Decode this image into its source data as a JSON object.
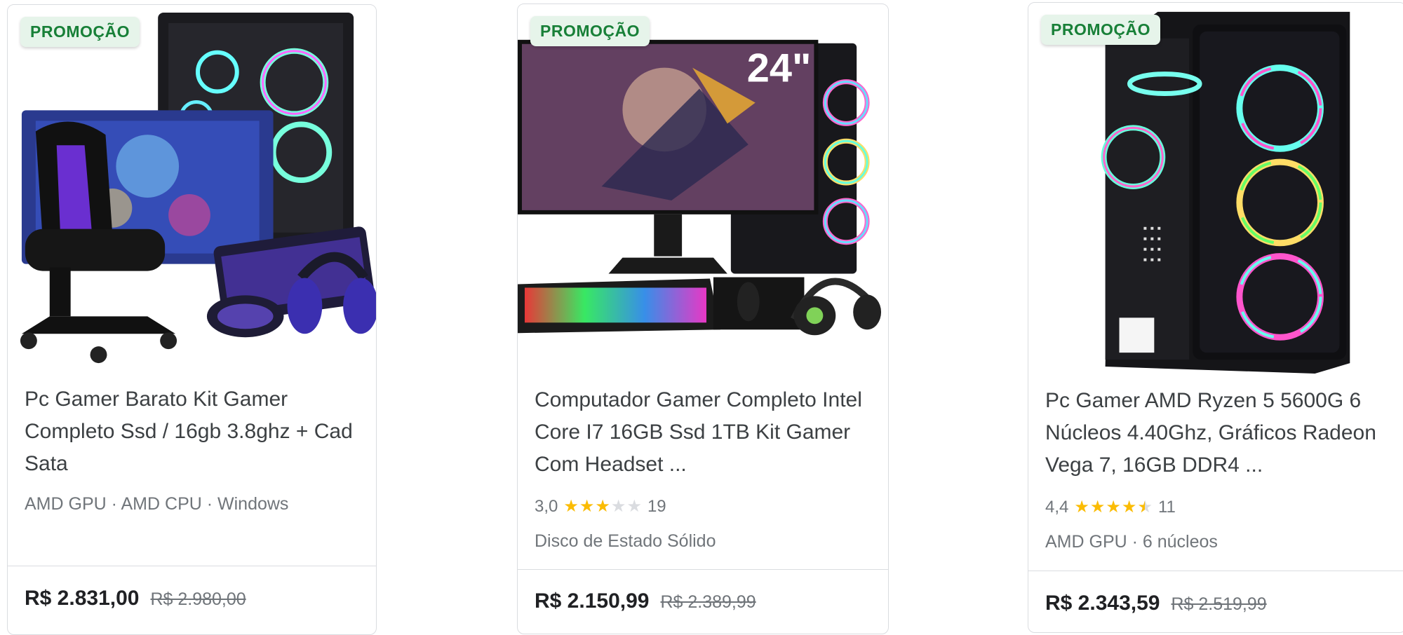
{
  "products": [
    {
      "badge": "PROMOÇÃO",
      "title": "Pc Gamer Barato Kit Gamer Completo Ssd / 16gb 3.8ghz + Cad Sata",
      "meta": "AMD GPU · AMD CPU · Windows",
      "price": "R$ 2.831,00",
      "old_price": "R$ 2.980,00",
      "image_icon": "gamer-kit-chair-image"
    },
    {
      "badge": "PROMOÇÃO",
      "title": "Computador Gamer Completo Intel Core I7 16GB Ssd 1TB Kit Gamer Com Headset ...",
      "rating_value": "3,0",
      "rating": 3.0,
      "review_count": "19",
      "meta": "Disco de Estado Sólido",
      "price": "R$ 2.150,99",
      "old_price": "R$ 2.389,99",
      "monitor_label": "24\"",
      "image_icon": "monitor-pc-kit-image"
    },
    {
      "badge": "PROMOÇÃO",
      "title": "Pc Gamer AMD Ryzen 5 5600G 6 Núcleos 4.40Ghz, Gráficos Radeon Vega 7, 16GB DDR4 ...",
      "rating_value": "4,4",
      "rating": 4.4,
      "review_count": "11",
      "meta": "AMD GPU · 6 núcleos",
      "price": "R$ 2.343,59",
      "old_price": "R$ 2.519,99",
      "image_icon": "pc-case-rgb-image"
    }
  ],
  "colors": {
    "badge_bg": "#e6f4ea",
    "badge_text": "#188038",
    "star": "#fbbc04",
    "text": "#3c4043",
    "muted": "#70757a"
  }
}
